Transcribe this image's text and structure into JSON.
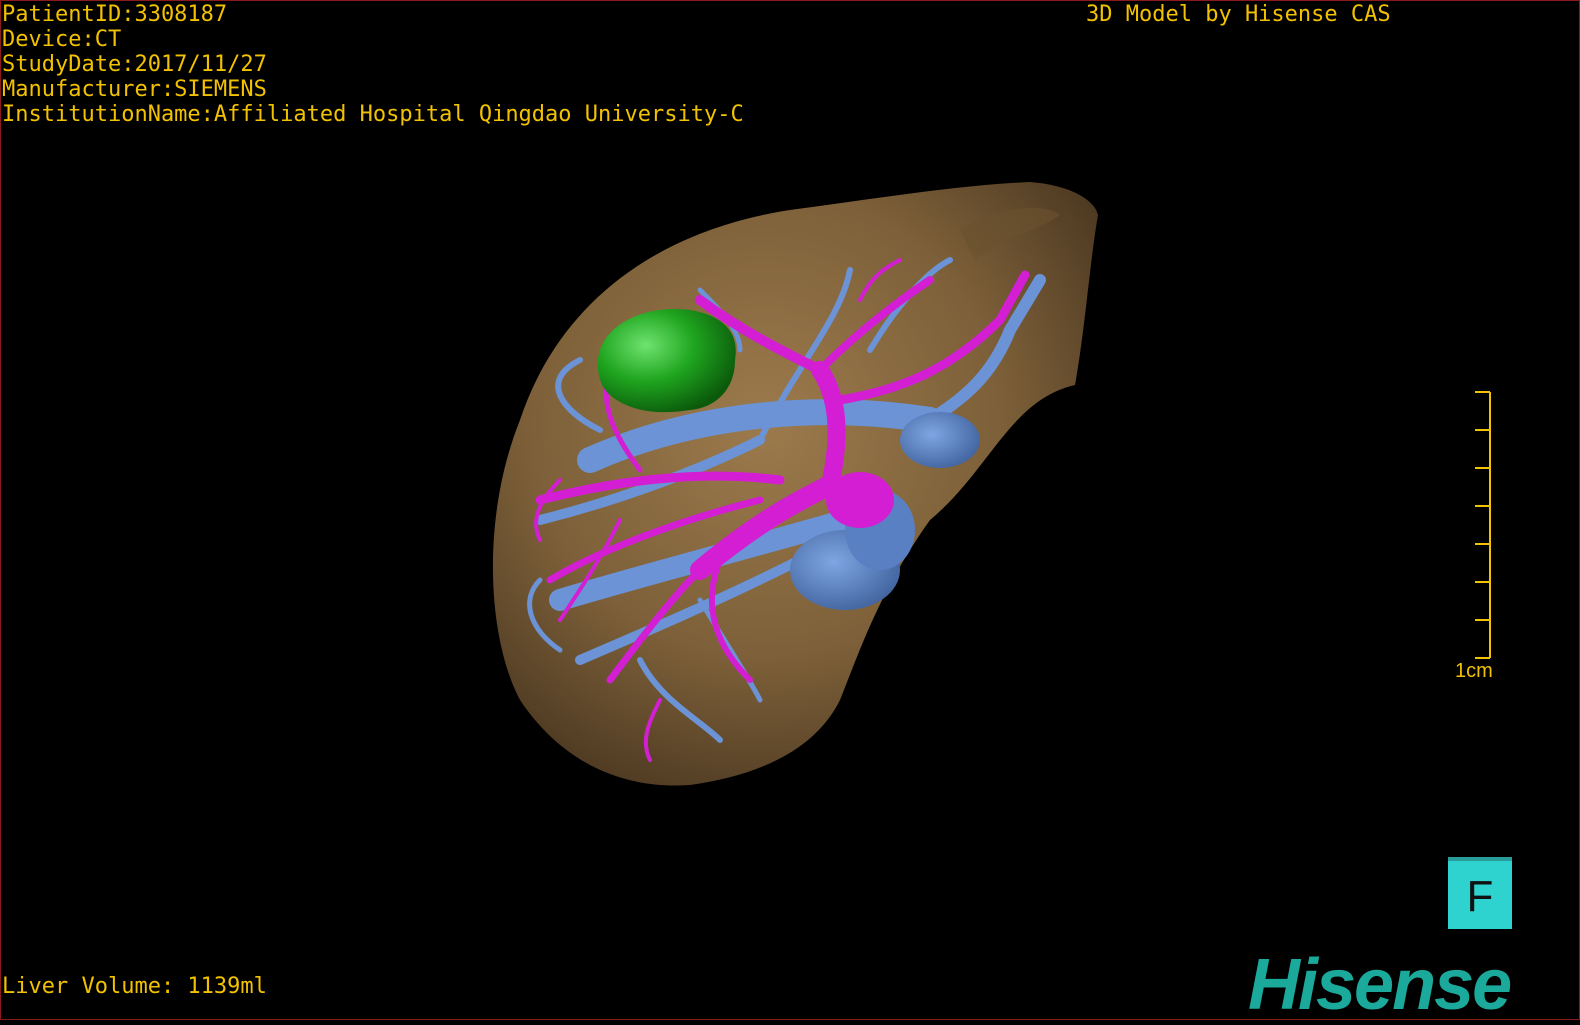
{
  "header": {
    "patient_id": "PatientID:3308187",
    "device": "Device:CT",
    "study_date": "StudyDate:2017/11/27",
    "manufacturer": "Manufacturer:SIEMENS",
    "institution": "InstitutionName:Affiliated Hospital Qingdao University-C"
  },
  "credit": "3D Model by Hisense CAS",
  "liver_volume": "Liver Volume: 1139ml",
  "scale_bar": {
    "label": "1cm"
  },
  "orientation": {
    "label": "F"
  },
  "logo": "Hisense",
  "colors": {
    "text": "#f2c200",
    "liver": "#8b6b42",
    "portal_vein": "#d41ed4",
    "hepatic_vein": "#6b93d6",
    "tumor": "#1fa51f",
    "logo": "#1aa99a",
    "orientation_box": "#2ed3d0"
  }
}
